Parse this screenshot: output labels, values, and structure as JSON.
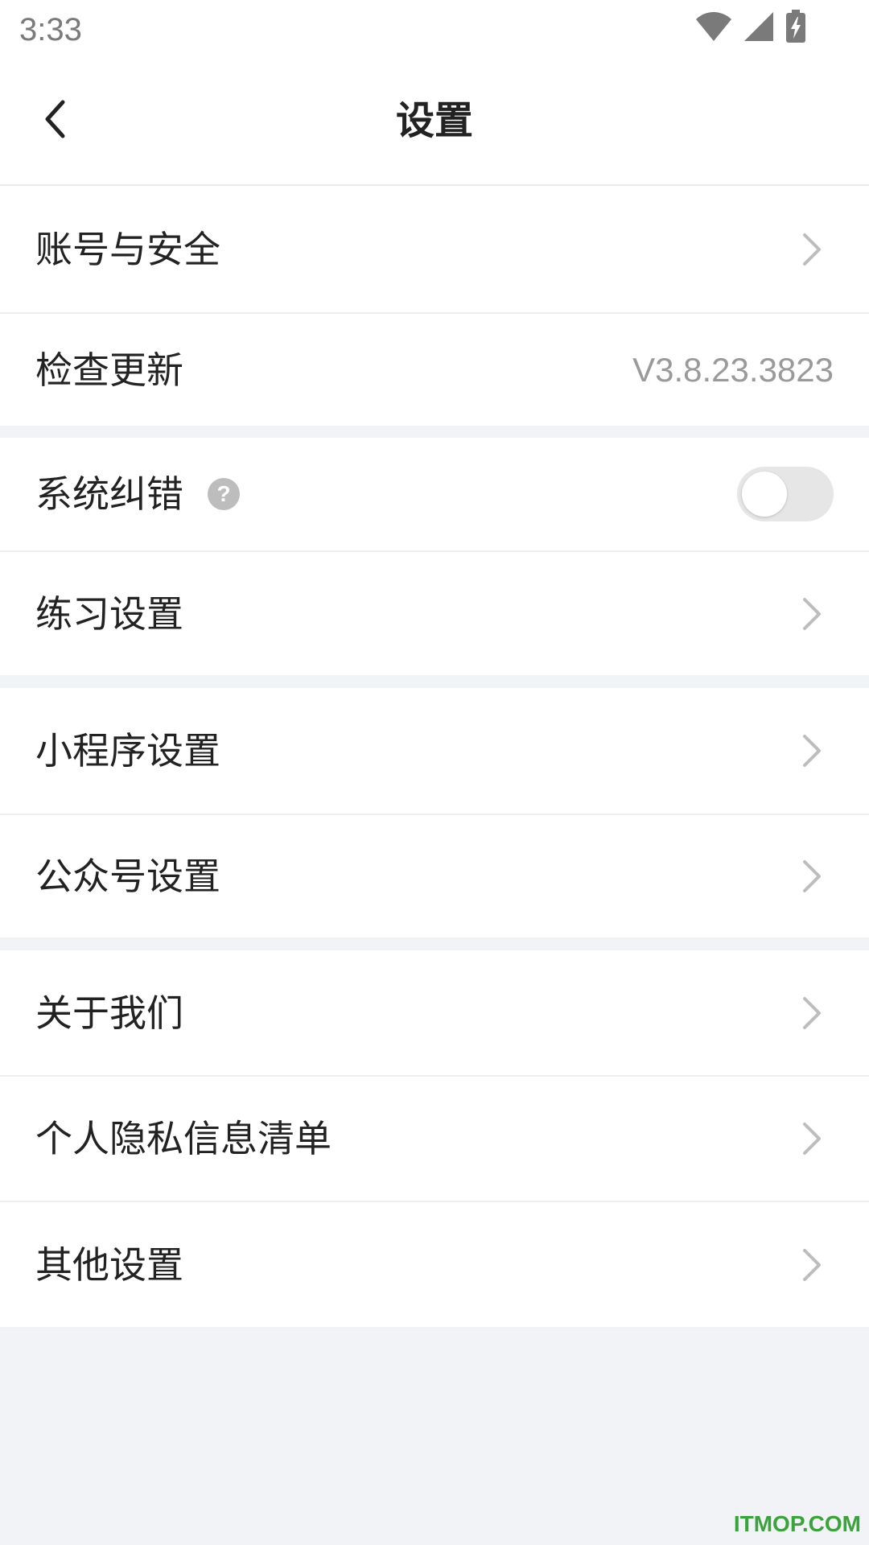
{
  "status_bar": {
    "time": "3:33",
    "icons": [
      "wifi-icon",
      "cellular-signal-icon",
      "battery-charging-icon"
    ]
  },
  "header": {
    "title": "设置",
    "back_icon": "chevron-left-icon"
  },
  "groups": [
    {
      "items": [
        {
          "label": "账号与安全",
          "trailing": "chevron-right-icon"
        },
        {
          "label": "检查更新",
          "value": "V3.8.23.3823"
        }
      ]
    },
    {
      "items": [
        {
          "label": "系统纠错",
          "help_icon_text": "?",
          "toggle_on": false
        },
        {
          "label": "练习设置",
          "trailing": "chevron-right-icon"
        }
      ]
    },
    {
      "items": [
        {
          "label": "小程序设置",
          "trailing": "chevron-right-icon"
        },
        {
          "label": "公众号设置",
          "trailing": "chevron-right-icon"
        }
      ]
    },
    {
      "items": [
        {
          "label": "关于我们",
          "trailing": "chevron-right-icon"
        },
        {
          "label": "个人隐私信息清单",
          "trailing": "chevron-right-icon"
        },
        {
          "label": "其他设置",
          "trailing": "chevron-right-icon"
        }
      ]
    }
  ],
  "watermark": "ITMOP.COM",
  "colors": {
    "background": "#F2F3F7",
    "surface": "#FFFFFF",
    "text_primary": "#222222",
    "text_secondary": "#9A9A9A",
    "toggle_off": "#E6E6E6",
    "watermark": "#3BA33B"
  }
}
